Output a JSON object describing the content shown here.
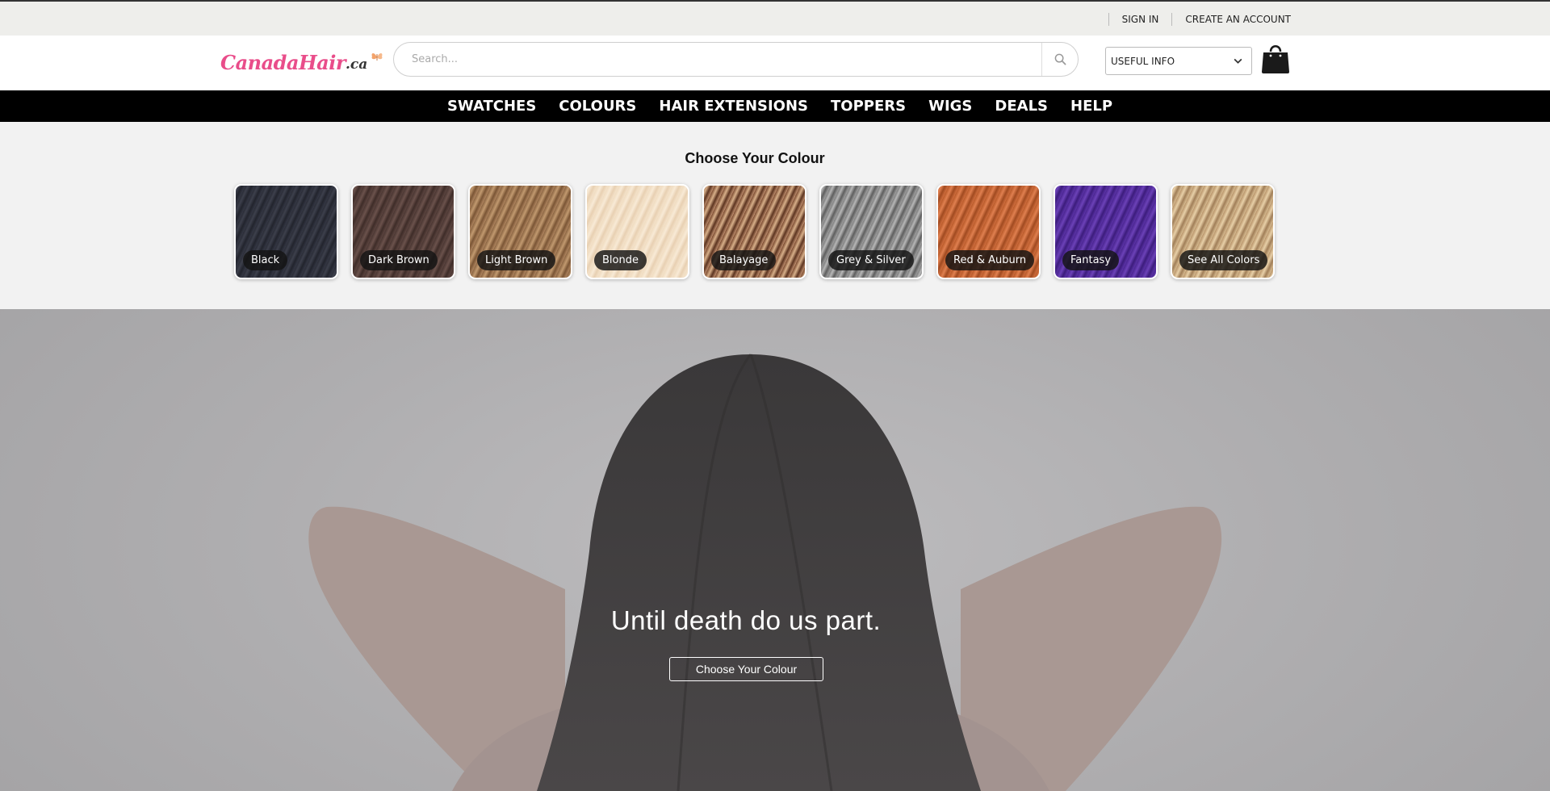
{
  "topbar": {
    "sign_in": "SIGN IN",
    "create_account": "CREATE AN ACCOUNT"
  },
  "header": {
    "logo_main": "CanadaHair",
    "logo_suffix": ".ca",
    "search_placeholder": "Search...",
    "useful_info": "USEFUL INFO",
    "icons": [
      "search-icon",
      "chevron-down-icon",
      "shopping-bag-icon",
      "butterfly-icon"
    ]
  },
  "nav": {
    "items": [
      "SWATCHES",
      "COLOURS",
      "HAIR EXTENSIONS",
      "TOPPERS",
      "WIGS",
      "DEALS",
      "HELP"
    ]
  },
  "colours": {
    "title": "Choose Your Colour",
    "swatches": [
      "Black",
      "Dark Brown",
      "Light Brown",
      "Blonde",
      "Balayage",
      "Grey & Silver",
      "Red & Auburn",
      "Fantasy",
      "See All Colors"
    ]
  },
  "hero": {
    "title": "Until death do us part.",
    "button": "Choose Your Colour"
  },
  "colors": {
    "brand_pink": "#e94d8a",
    "nav_bg": "#000000",
    "topbar_bg": "#eeeeeb",
    "section_bg": "#f2f2f2"
  }
}
